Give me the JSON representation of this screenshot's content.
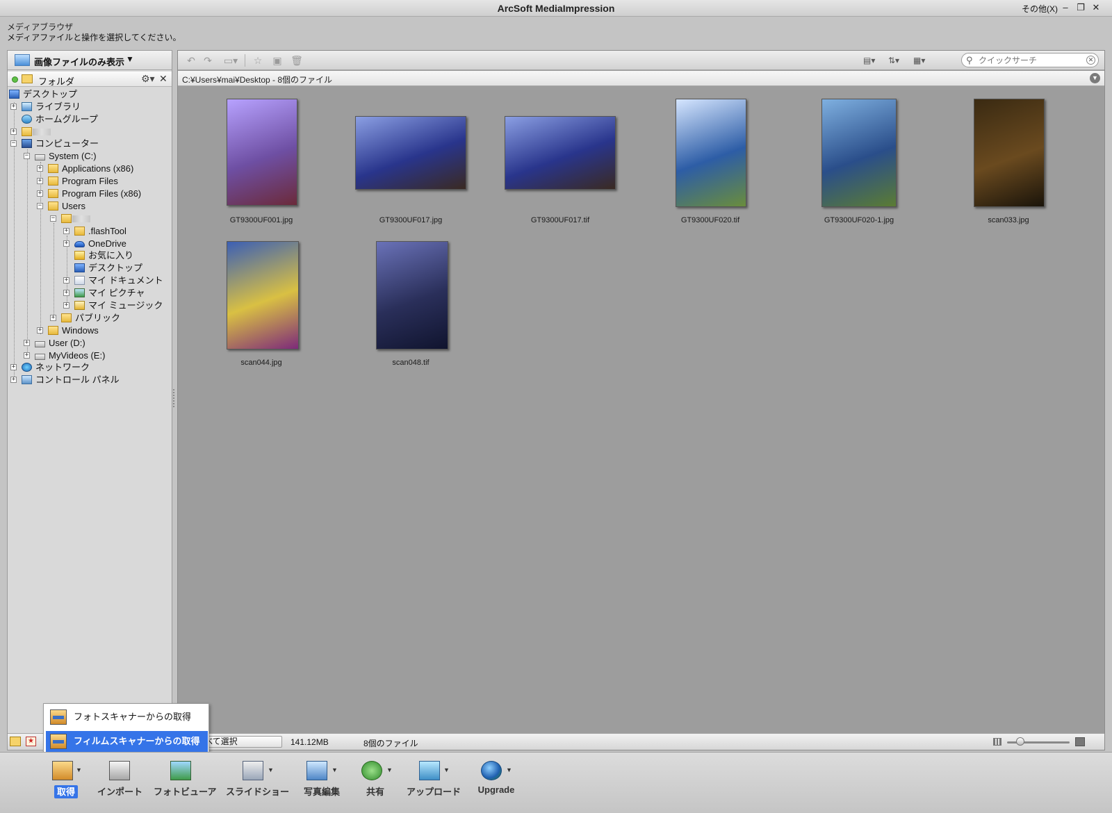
{
  "window": {
    "title": "ArcSoft MediaImpression",
    "more_label": "その他(X)"
  },
  "header": {
    "title": "メディアブラウザ",
    "subtitle": "メディアファイルと操作を選択してください。"
  },
  "filter": {
    "label": "画像ファイルのみ表示"
  },
  "folder_panel": {
    "label": "フォルダ"
  },
  "tree": {
    "desktop": "デスクトップ",
    "library": "ライブラリ",
    "homegroup": "ホームグループ",
    "computer": "コンピューター",
    "system_c": "System (C:)",
    "applications_x86": "Applications (x86)",
    "program_files": "Program Files",
    "program_files_x86": "Program Files (x86)",
    "users": "Users",
    "flashtool": ".flashTool",
    "onedrive": "OneDrive",
    "favorites": "お気に入り",
    "user_desktop": "デスクトップ",
    "my_documents": "マイ ドキュメント",
    "my_pictures": "マイ ピクチャ",
    "my_music": "マイ ミュージック",
    "public": "パブリック",
    "windows": "Windows",
    "user_d": "User (D:)",
    "myvideos_e": "MyVideos (E:)",
    "network": "ネットワーク",
    "control_panel": "コントロール パネル"
  },
  "search": {
    "placeholder": "クイックサーチ"
  },
  "path": {
    "text": "C:¥Users¥mai¥Desktop - 8個のファイル"
  },
  "files": [
    {
      "name": "GT9300UF001.jpg",
      "palette": [
        "#b7a2ff",
        "#6e4fa3",
        "#6b2a3a"
      ]
    },
    {
      "name": "GT9300UF017.jpg",
      "palette": [
        "#8b9fe3",
        "#29358c",
        "#3a2a22"
      ]
    },
    {
      "name": "GT9300UF017.tif",
      "palette": [
        "#8b9fe3",
        "#29358c",
        "#3a2a22"
      ]
    },
    {
      "name": "GT9300UF020.tif",
      "palette": [
        "#d6e6ff",
        "#2d5da6",
        "#6a8d3c"
      ]
    },
    {
      "name": "GT9300UF020-1.jpg",
      "palette": [
        "#7fb0e0",
        "#2a4e8a",
        "#5b7c33"
      ]
    },
    {
      "name": "scan033.jpg",
      "palette": [
        "#3a2a12",
        "#6a4a1f",
        "#1a140a"
      ]
    },
    {
      "name": "scan044.jpg",
      "palette": [
        "#3b5fb5",
        "#d9c043",
        "#7d2a7a"
      ]
    },
    {
      "name": "scan048.tif",
      "palette": [
        "#6a72b8",
        "#2a2f5a",
        "#10142e"
      ]
    }
  ],
  "status": {
    "select_all": "すべて選択",
    "size": "141.12MB",
    "count": "8個のファイル"
  },
  "popup": {
    "items": [
      {
        "label": "フォトスキャナーからの取得"
      },
      {
        "label": "フィルムスキャナーからの取得"
      }
    ]
  },
  "bottom": {
    "acquire": "取得",
    "import": "インポート",
    "photo_viewer": "フォトビューア",
    "slideshow": "スライドショー",
    "photo_edit": "写真編集",
    "share": "共有",
    "upload": "アップロード",
    "upgrade": "Upgrade"
  },
  "colors": {
    "accent": "#3574e8",
    "panel_bg": "#9d9d9d"
  }
}
